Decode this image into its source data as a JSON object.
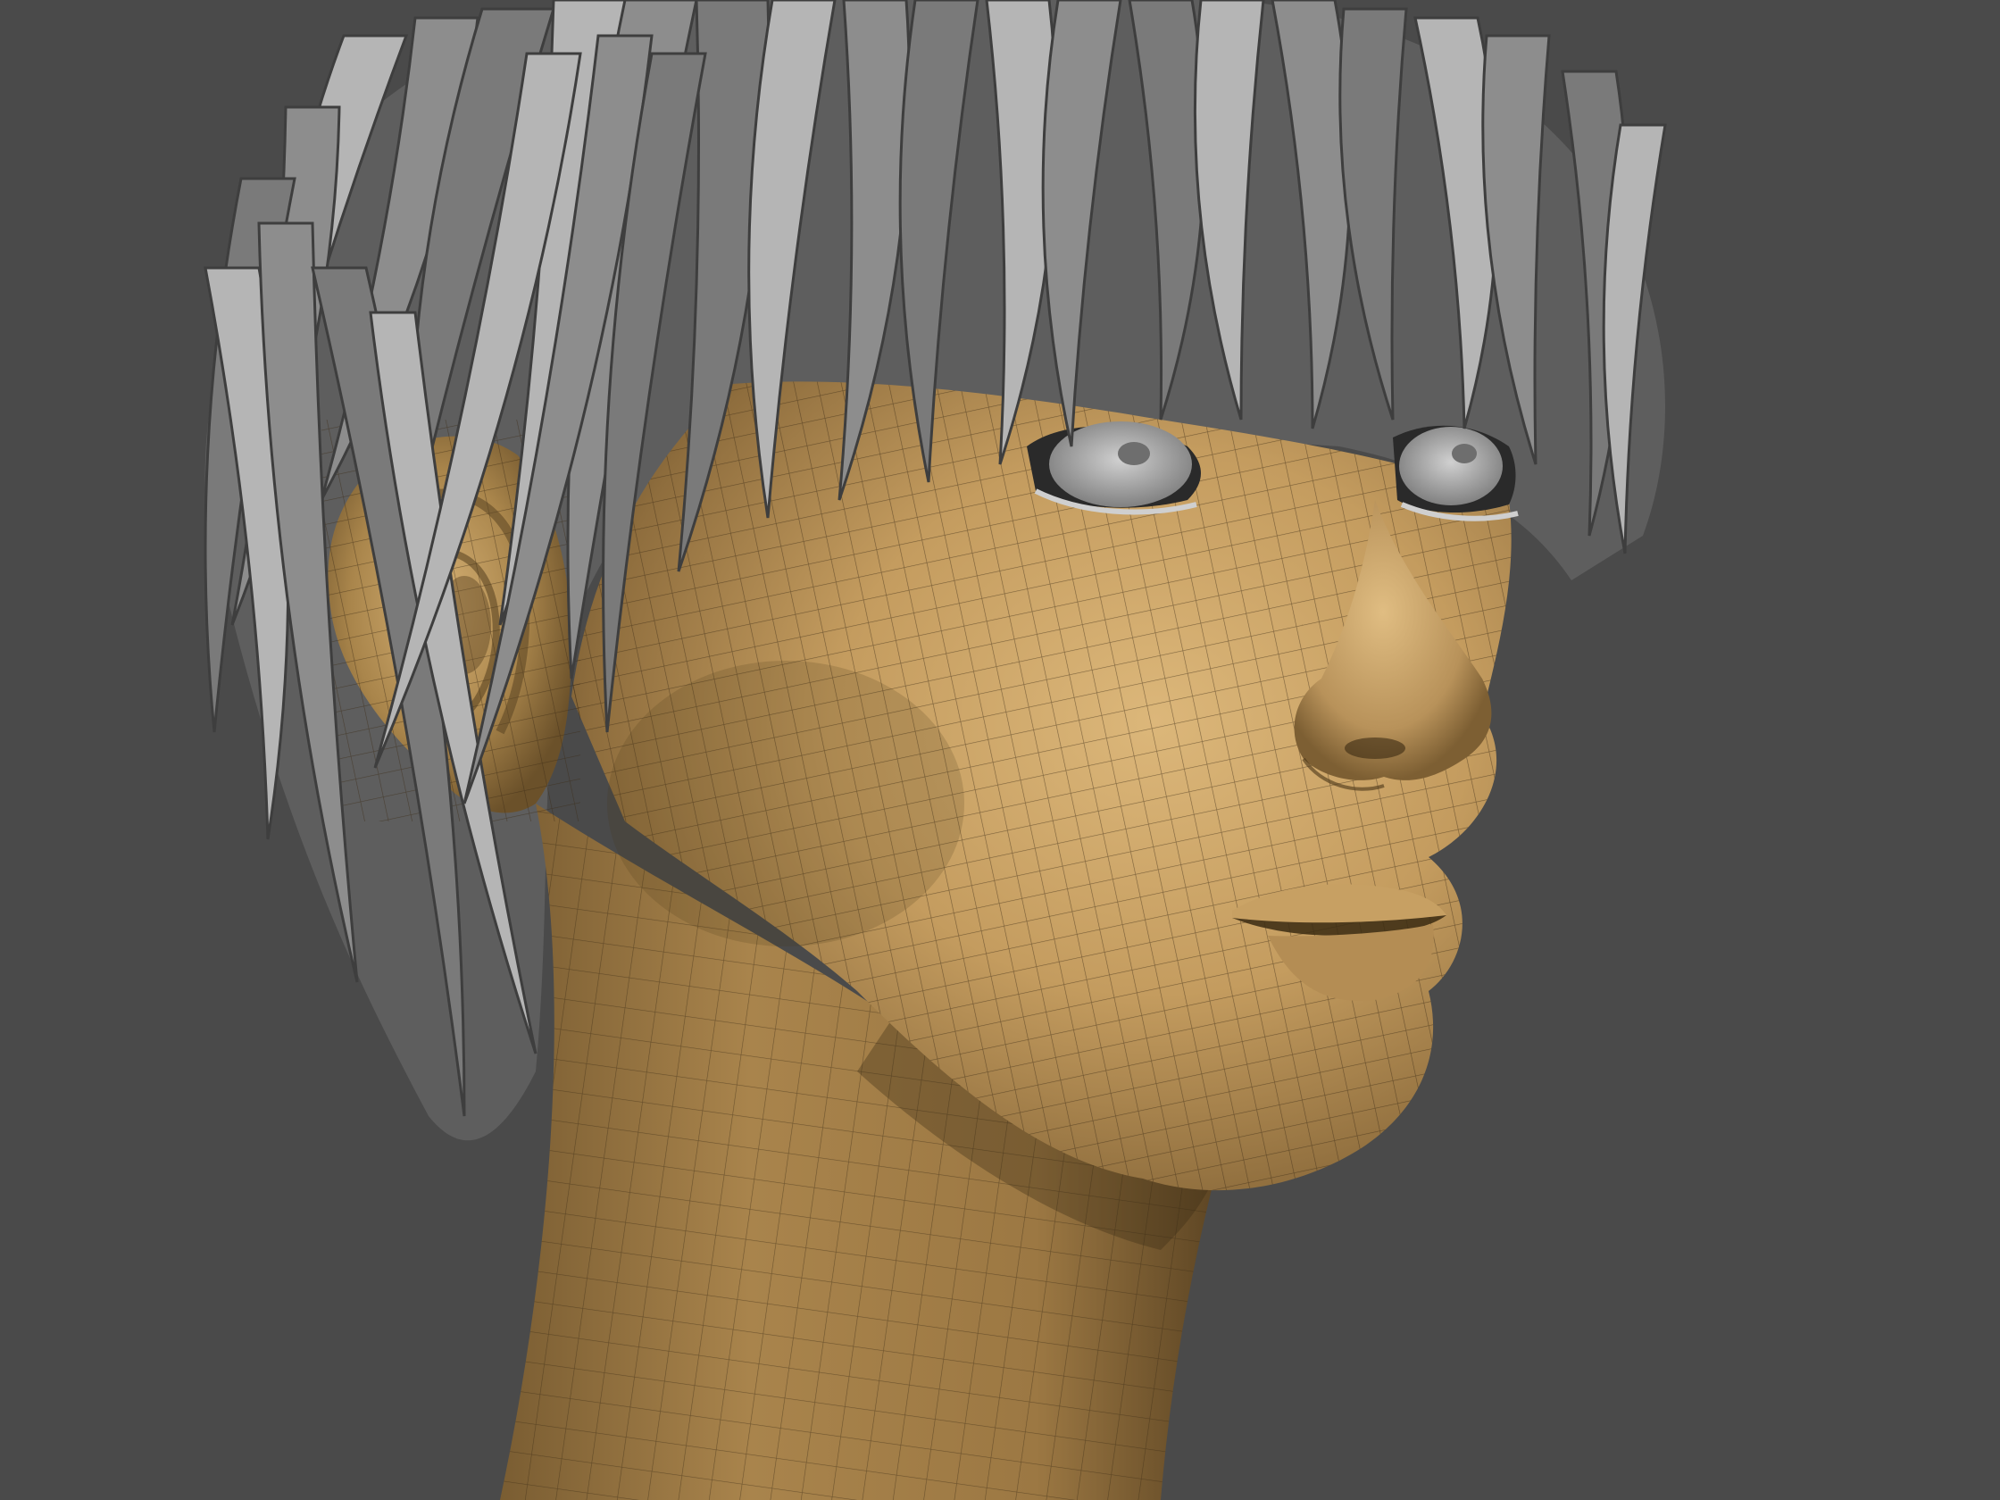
{
  "scene": {
    "background_color": "#4a4a4a",
    "skin_color": "#c8a56a",
    "skin_shadow_color": "#6e5530",
    "hair_color": "#8d8d8d",
    "hair_highlight_color": "#b5b5b5",
    "hair_shadow_color": "#3e3e3e",
    "wire_color": "#3a2a14",
    "eye_color": "#b9b9b9"
  }
}
